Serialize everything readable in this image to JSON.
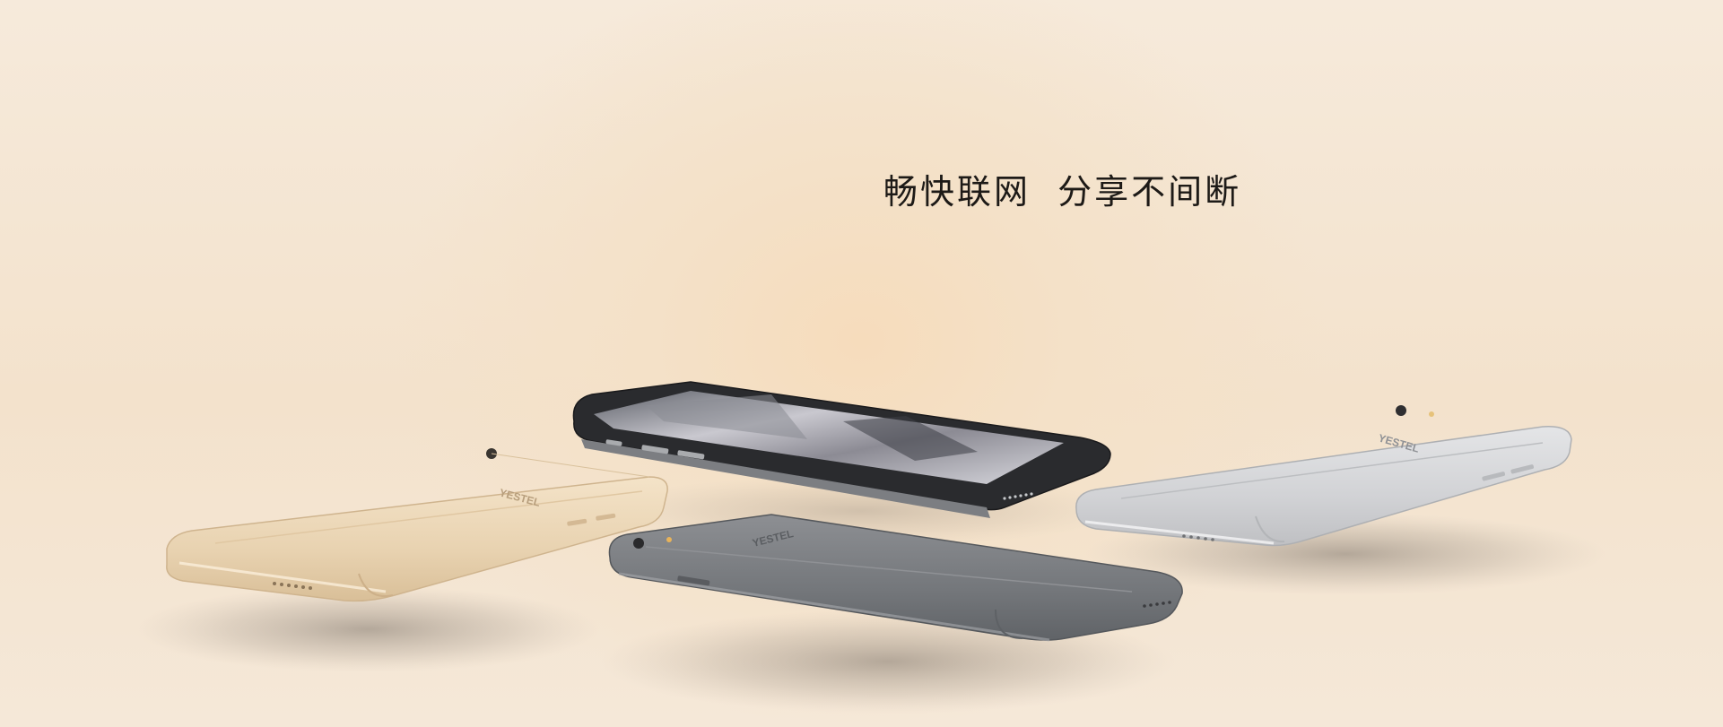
{
  "headline": "畅快联网  分享不间断",
  "phones": [
    {
      "finish": "gold",
      "brand": "YESTEL",
      "color": "#ecd6b6"
    },
    {
      "finish": "black-front",
      "brand": "",
      "color": "#1b1b1d"
    },
    {
      "finish": "space-gray",
      "brand": "YESTEL",
      "color": "#7b7d81"
    },
    {
      "finish": "silver",
      "brand": "YESTEL",
      "color": "#d6d7d9"
    }
  ],
  "colors": {
    "background": "#f3e4cf",
    "text": "#1d1a17"
  }
}
